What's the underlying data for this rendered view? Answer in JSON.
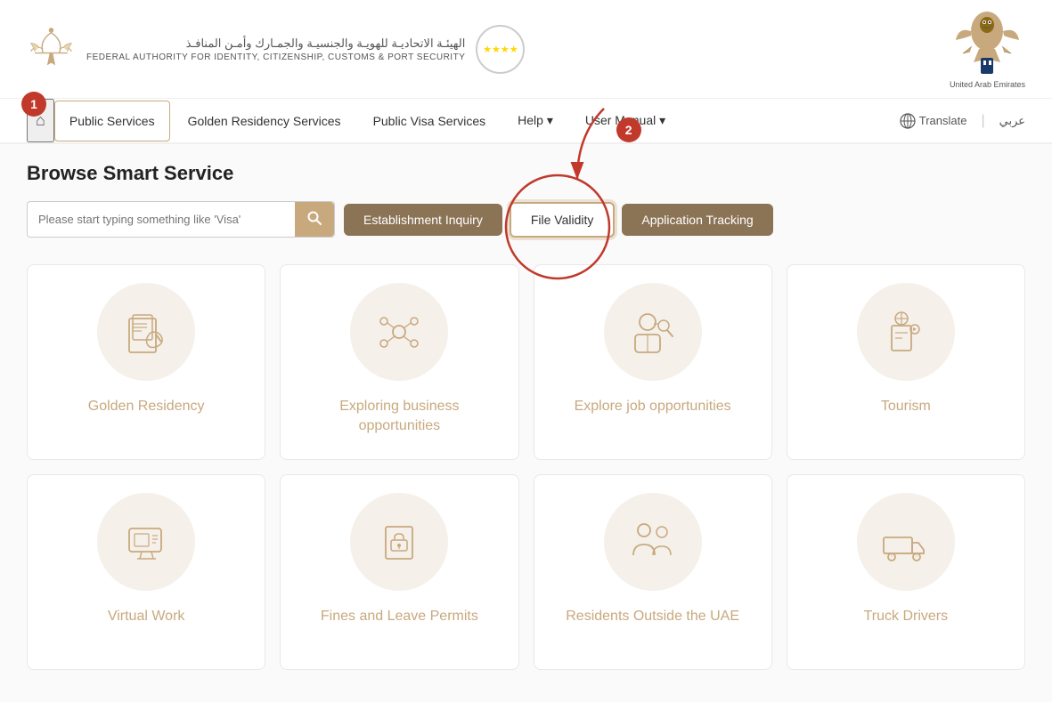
{
  "header": {
    "arabic_title": "الهيئـة الاتحاديـة للهويـة والجنسيـة والجمـارك وأمـن المنافـذ",
    "english_title": "FEDERAL AUTHORITY FOR IDENTITY, CITIZENSHIP, CUSTOMS & PORT SECURITY",
    "stars": "★★★★",
    "uae_text": "United Arab Emirates"
  },
  "navbar": {
    "home_icon": "⌂",
    "items": [
      {
        "label": "Public Services",
        "active": true
      },
      {
        "label": "Golden Residency Services",
        "active": false
      },
      {
        "label": "Public Visa Services",
        "active": false
      },
      {
        "label": "Help ▾",
        "active": false
      },
      {
        "label": "User Manual ▾",
        "active": false
      }
    ],
    "translate_label": "Translate",
    "arabic_label": "عربي"
  },
  "main": {
    "browse_title": "Browse Smart Service",
    "search_placeholder": "Please start typing something like 'Visa'",
    "search_icon": "🔍",
    "buttons": {
      "establishment": "Establishment Inquiry",
      "file_validity": "File Validity",
      "application_tracking": "Application Tracking"
    },
    "cards_row1": [
      {
        "label": "Golden Residency",
        "icon": "🖼"
      },
      {
        "label": "Exploring business opportunities",
        "icon": "🔗"
      },
      {
        "label": "Explore job opportunities",
        "icon": "🔍"
      },
      {
        "label": "Tourism",
        "icon": "🌐"
      }
    ],
    "cards_row2": [
      {
        "label": "Virtual Work",
        "icon": "🖥"
      },
      {
        "label": "Fines and Leave Permits",
        "icon": "📋"
      },
      {
        "label": "Residents Outside the UAE",
        "icon": "👥"
      },
      {
        "label": "Truck Drivers",
        "icon": "🚚"
      }
    ]
  },
  "annotations": {
    "badge1": "1",
    "badge2": "2"
  }
}
